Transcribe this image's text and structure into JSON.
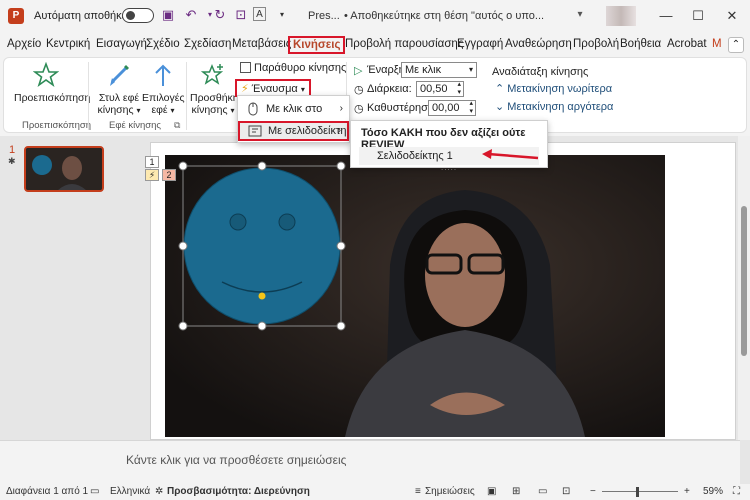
{
  "titlebar": {
    "autosave_label": "Αυτόματη αποθήκευση",
    "app_logo": "P",
    "doc_title_short": "Pres...",
    "doc_title": "•  Αποθηκεύτηκε στη θέση \"αυτός ο υπο...",
    "minimize": "—",
    "maximize": "☐",
    "close": "✕"
  },
  "tabs": [
    "Αρχείο",
    "Κεντρική",
    "Εισαγωγή",
    "Σχέδιο",
    "Σχεδίαση",
    "Μεταβάσεις",
    "Κινήσεις",
    "Προβολή παρουσίασης",
    "Εγγραφή",
    "Αναθεώρηση",
    "Προβολή",
    "Βοήθεια",
    "Acrobat",
    "M"
  ],
  "ribbon": {
    "preview": "Προεπισκόπηση",
    "preview_group": "Προεπισκόπηση",
    "motion_style_1": "Στυλ εφέ",
    "motion_style_2": "κίνησης",
    "effect_options_1": "Επιλογές",
    "effect_options_2": "εφέ",
    "motion_effects_group": "Εφέ κίνησης",
    "add_motion_1": "Προσθήκη",
    "add_motion_2": "κίνησης",
    "animation_pane": "Παράθυρο κίνησης",
    "trigger": "Έναυσμα",
    "start_label": "Έναρξη:",
    "start_value": "Με κλικ",
    "duration_label": "Διάρκεια:",
    "duration_value": "00,50",
    "delay_label": "Καθυστέρηση:",
    "delay_value": "00,00",
    "reorder_title": "Αναδιάταξη κίνησης",
    "move_earlier": "Μετακίνηση νωρίτερα",
    "move_later": "Μετακίνηση αργότερα"
  },
  "trigger_menu": {
    "on_click": "Με κλικ στο",
    "on_bookmark": "Με σελιδοδείκτη"
  },
  "bookmark_submenu": {
    "header": "Τόσο ΚΑΚΗ που δεν αξίζει ούτε REVIEW",
    "item": "Σελιδοδείκτης 1",
    "dots": "....."
  },
  "slide": {
    "thumb_number": "1",
    "anim_tag_1": "1",
    "anim_tag_2": "2"
  },
  "notes": {
    "placeholder": "Κάντε κλικ για να προσθέσετε σημειώσεις"
  },
  "status": {
    "slide_info": "Διαφάνεια 1 από 1",
    "language": "Ελληνικά",
    "accessibility": "Προσβασιμότητα: Διερεύνηση",
    "notes": "Σημειώσεις",
    "zoom": "59%",
    "zoom_minus": "−",
    "zoom_plus": "+"
  },
  "colors": {
    "accent": "#c43e1c",
    "highlight_border": "#d8162a",
    "smiley": "#1b6a8f"
  }
}
